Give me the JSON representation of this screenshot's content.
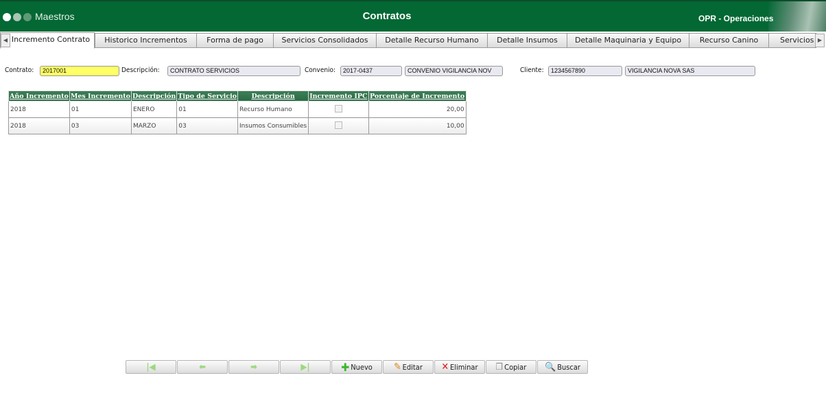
{
  "header": {
    "app": "Maestros",
    "title": "Contratos",
    "module": "OPR - Operaciones"
  },
  "tabs": [
    "Incremento Contrato",
    "Historico Incrementos",
    "Forma de pago",
    "Servicios Consolidados",
    "Detalle Recurso Humano",
    "Detalle Insumos",
    "Detalle Maquinaria y Equipo",
    "Recurso Canino",
    "Servicios ("
  ],
  "form": {
    "contrato_label": "Contrato:",
    "contrato": "2017001",
    "descripcion_label": "Descripción:",
    "descripcion": "CONTRATO SERVICIOS",
    "convenio_label": "Convenio:",
    "convenio": "2017-0437",
    "convenio_desc": "CONVENIO  VIGILANCIA NOV",
    "cliente_label": "Cliente:",
    "cliente": "1234567890",
    "cliente_desc": "VIGILANCIA NOVA SAS"
  },
  "table": {
    "headers": [
      "Año Incremento",
      "Mes Incremento",
      "Descripción",
      "Tipo de Servicio",
      "Descripción",
      "Incremento IPC",
      "Porcentaje de Incremento"
    ],
    "rows": [
      [
        "2018",
        "01",
        "ENERO",
        "01",
        "Recurso Humano",
        false,
        "20,00"
      ],
      [
        "2018",
        "03",
        "MARZO",
        "03",
        "Insumos Consumibles",
        false,
        "10,00"
      ]
    ]
  },
  "toolbar": {
    "nuevo": "Nuevo",
    "editar": "Editar",
    "eliminar": "Eliminar",
    "copiar": "Copiar",
    "buscar": "Buscar"
  },
  "colors": {
    "header": "#036834",
    "contrato_highlight": "#ffff66"
  }
}
